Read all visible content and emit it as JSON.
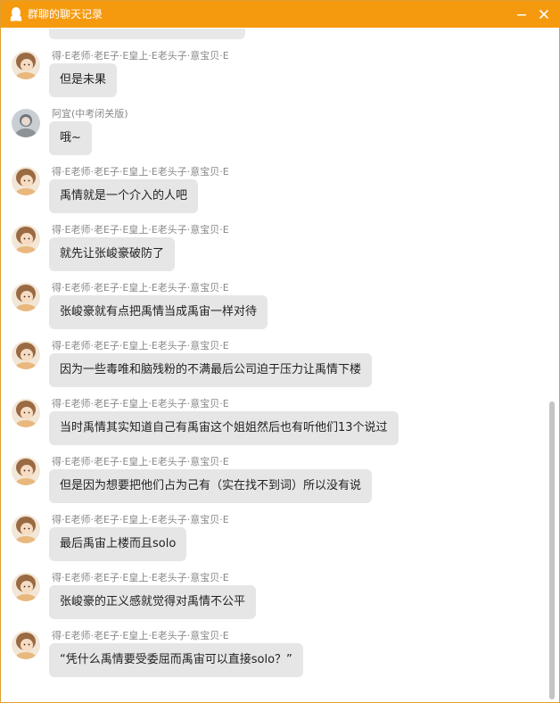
{
  "window": {
    "title": "群聊的聊天记录"
  },
  "colors": {
    "titlebar": "#f59a0f",
    "bubble": "#e6e6e6",
    "sender": "#888888"
  },
  "messages": [
    {
      "sender": "得·E老师·老E子·E皇上·E老头子·意宝贝·E",
      "text": "但是未果",
      "avatar": "avatar-girl"
    },
    {
      "sender": "阿宜(中考闭关版)",
      "text": "哦~",
      "avatar": "avatar-gray"
    },
    {
      "sender": "得·E老师·老E子·E皇上·E老头子·意宝贝·E",
      "text": "禹情就是一个介入的人吧",
      "avatar": "avatar-girl"
    },
    {
      "sender": "得·E老师·老E子·E皇上·E老头子·意宝贝·E",
      "text": "就先让张峻豪破防了",
      "avatar": "avatar-girl"
    },
    {
      "sender": "得·E老师·老E子·E皇上·E老头子·意宝贝·E",
      "text": "张峻豪就有点把禹情当成禹宙一样对待",
      "avatar": "avatar-girl"
    },
    {
      "sender": "得·E老师·老E子·E皇上·E老头子·意宝贝·E",
      "text": "因为一些毒唯和脑残粉的不满最后公司迫于压力让禹情下楼",
      "avatar": "avatar-girl"
    },
    {
      "sender": "得·E老师·老E子·E皇上·E老头子·意宝贝·E",
      "text": "当时禹情其实知道自己有禹宙这个姐姐然后也有听他们13个说过",
      "avatar": "avatar-girl"
    },
    {
      "sender": "得·E老师·老E子·E皇上·E老头子·意宝贝·E",
      "text": "但是因为想要把他们占为己有（实在找不到词）所以没有说",
      "avatar": "avatar-girl"
    },
    {
      "sender": "得·E老师·老E子·E皇上·E老头子·意宝贝·E",
      "text": "最后禹宙上楼而且solo",
      "avatar": "avatar-girl"
    },
    {
      "sender": "得·E老师·老E子·E皇上·E老头子·意宝贝·E",
      "text": "张峻豪的正义感就觉得对禹情不公平",
      "avatar": "avatar-girl"
    },
    {
      "sender": "得·E老师·老E子·E皇上·E老头子·意宝贝·E",
      "text": "“凭什么禹情要受委屈而禹宙可以直接solo？”",
      "avatar": "avatar-girl"
    }
  ]
}
